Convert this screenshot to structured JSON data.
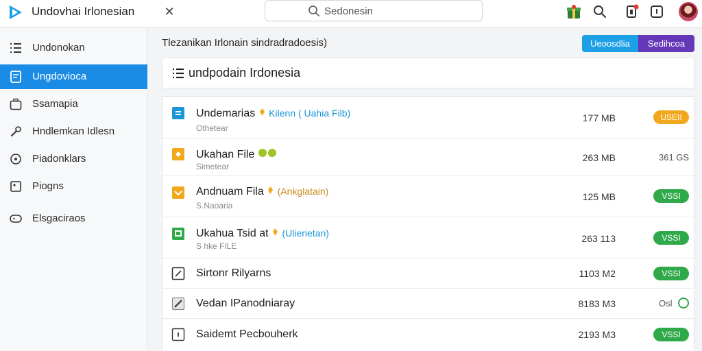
{
  "app": {
    "title": "Undovhai Irlonesian",
    "logo_icon": "play-logo-icon"
  },
  "search": {
    "value": "Sedonesin"
  },
  "colors": {
    "accent": "#1a8ce6",
    "button_blue": "#1ea0e6",
    "button_purple": "#6438b8",
    "badge_orange": "#f2a81d",
    "badge_green": "#2fa94a"
  },
  "sidebar": {
    "items": [
      {
        "label": "Undonokan",
        "icon": "list-icon"
      },
      {
        "label": "Ungdovioca",
        "icon": "document-icon",
        "active": true
      },
      {
        "label": "Ssamapia",
        "icon": "briefcase-icon"
      },
      {
        "label": "Hndlemkan Idlesn",
        "icon": "wrench-icon"
      },
      {
        "label": "Piadonklars",
        "icon": "target-icon"
      },
      {
        "label": "Piogns",
        "icon": "puzzle-icon"
      },
      {
        "label": "Elsgaciraos",
        "icon": "gamepad-icon"
      }
    ]
  },
  "main": {
    "subtitle": "Tlezanikan Irlonain sindradradoesis)",
    "buttons": {
      "primary": "Ueoosdlia",
      "secondary": "Sedihcoa"
    },
    "heading": "undpodain Irdonesia"
  },
  "files": [
    {
      "name": "Undemarias",
      "tag": "Kilenn ( Uahia Filb)",
      "tag_color": "#1a95d6",
      "tag_prefix_icon": "pin-icon",
      "sub": "Othetear",
      "size": "177 MB",
      "status": "USEII",
      "status_style": "orange",
      "icon": "file-blue-icon"
    },
    {
      "name": "Ukahan File",
      "tag": "",
      "tag_color": "#7fb622",
      "sub": "Simetear",
      "size": "263 MB",
      "status": "361 GS",
      "status_style": "plain",
      "icon": "file-orange-icon"
    },
    {
      "name": "Andnuam Fila",
      "tag": "(Ankglatain)",
      "tag_color": "#c8891a",
      "tag_prefix_icon": "pin-icon",
      "sub": "S.Naoaria",
      "size": "125 MB",
      "status": "VSSI",
      "status_style": "green",
      "icon": "file-yellow-icon"
    },
    {
      "name": "Ukahua Tsid at",
      "tag": "(Ulierietan)",
      "tag_color": "#1a95d6",
      "tag_prefix_icon": "pin-icon",
      "sub": "S hke FILE",
      "size": "263 113",
      "status": "VSSI",
      "status_style": "green",
      "icon": "file-green-icon"
    },
    {
      "name": "Sirtonr Rilyarns",
      "tag": "",
      "sub": "",
      "size": "1103 M2",
      "status": "VSSI",
      "status_style": "green",
      "icon": "edit-icon"
    },
    {
      "name": "Vedan IPanodniaray",
      "tag": "",
      "sub": "",
      "size": "8183 M3",
      "status": "Osl",
      "status_style": "ring",
      "icon": "pencil-icon"
    },
    {
      "name": "Saidemt Pecbouherk",
      "tag": "",
      "sub": "",
      "size": "2193 M3",
      "status": "VSSI",
      "status_style": "green",
      "icon": "info-icon"
    }
  ]
}
